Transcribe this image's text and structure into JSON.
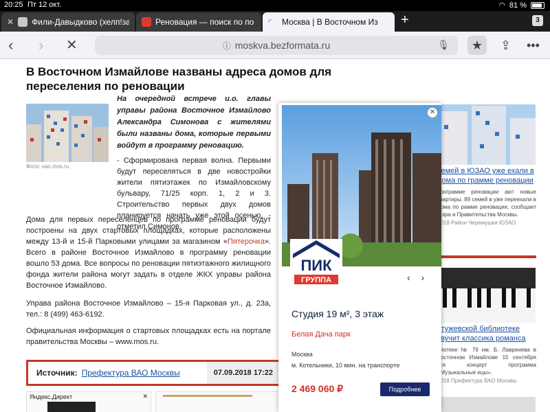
{
  "status": {
    "time": "20:25",
    "date": "Пт 12 окт.",
    "battery": "81 %"
  },
  "tabs": [
    {
      "title": "Фили-Давыдково (хелп!за"
    },
    {
      "title": "Реновация — поиск по по"
    },
    {
      "title": "Москва | В Восточном Из"
    }
  ],
  "tab_count": "3",
  "url": "moskva.bezformata.ru",
  "article": {
    "headline": "В Восточном Измайлове названы адреса домов для переселения по реновации",
    "lead": "На очередной встрече и.о. главы управы района Восточное Измайлово Александра Симонова с жителями были названы дома, которые первыми войдут в программу реновацию.",
    "caption": "Фото: vao.mos.ru",
    "p1": "- Сформирована первая волна. Первыми будут переселяться в две новостройки жители пятиэтажек по Измайловскому бульвару, 71/25 корп. 1, 2 и 3. Строительство первых двух домов планируется начать уже этой осенью, - отметил Симонов.",
    "p2_a": "Дома для первых переселенцев по программе реновации будут построены на двух стартовых площадках, которые расположены между 13-й и 15-й Парковыми улицами за магазином «",
    "p2_link": "Пятерочка",
    "p2_b": "». Всего в районе Восточное Измайлово в программу реновации вошло 53 дома. Все вопросы по реновации пятиэтажного жилищного фонда жители района могут задать в отделе ЖКХ управы района Восточное Измайлово.",
    "p3": "Управа района Восточное Измайлово – 15-я Парковая ул., д. 23а, тел.: 8 (499) 463-6192.",
    "p4": "Официальная информация о стартовых площадках есть на портале правительства Москвы – www.mos.ru.",
    "source_label": "Источник:",
    "source_name": "Префектура ВАО Москвы",
    "source_date": "07.09.2018 17:22"
  },
  "ad_strip": {
    "label": "Яндекс.Директ",
    "close": "✕"
  },
  "ad": {
    "logo_top": "ПИК",
    "logo_bottom": "ГРУППА",
    "title": "Студия 19 м², 3 этаж",
    "subtitle": "Белая Дача парк",
    "city": "Москва",
    "location": "м. Котельники, 10 мин. на транспорте",
    "price": "2 469 060 ₽",
    "button": "Подробнее",
    "close": "✕"
  },
  "side": {
    "item1_link": "семей в ЮЗАО уже ехали в дома по грамме реновации",
    "item1_text": "программе реновации ают новые квартиры. 89 семей в уже переехали в дома по рамме реновации, сообщает Мэра и Правительства Москвы.",
    "item1_meta": "2018 Район Черемушки ЮЗАО",
    "item2_link": "стужевской библиотеке звучит классика романса",
    "item2_text": "лиотеке № 79 им. Б. Лавренева в Восточном Измайлове 15 сентября тся концерт программа «Музыкальные ицы».",
    "item2_meta": "2018 Префектура ВАО Москвы"
  },
  "colors": {
    "accent_red": "#c0392b",
    "link_blue": "#1a4fa0",
    "ad_navy": "#1a2a6c"
  }
}
